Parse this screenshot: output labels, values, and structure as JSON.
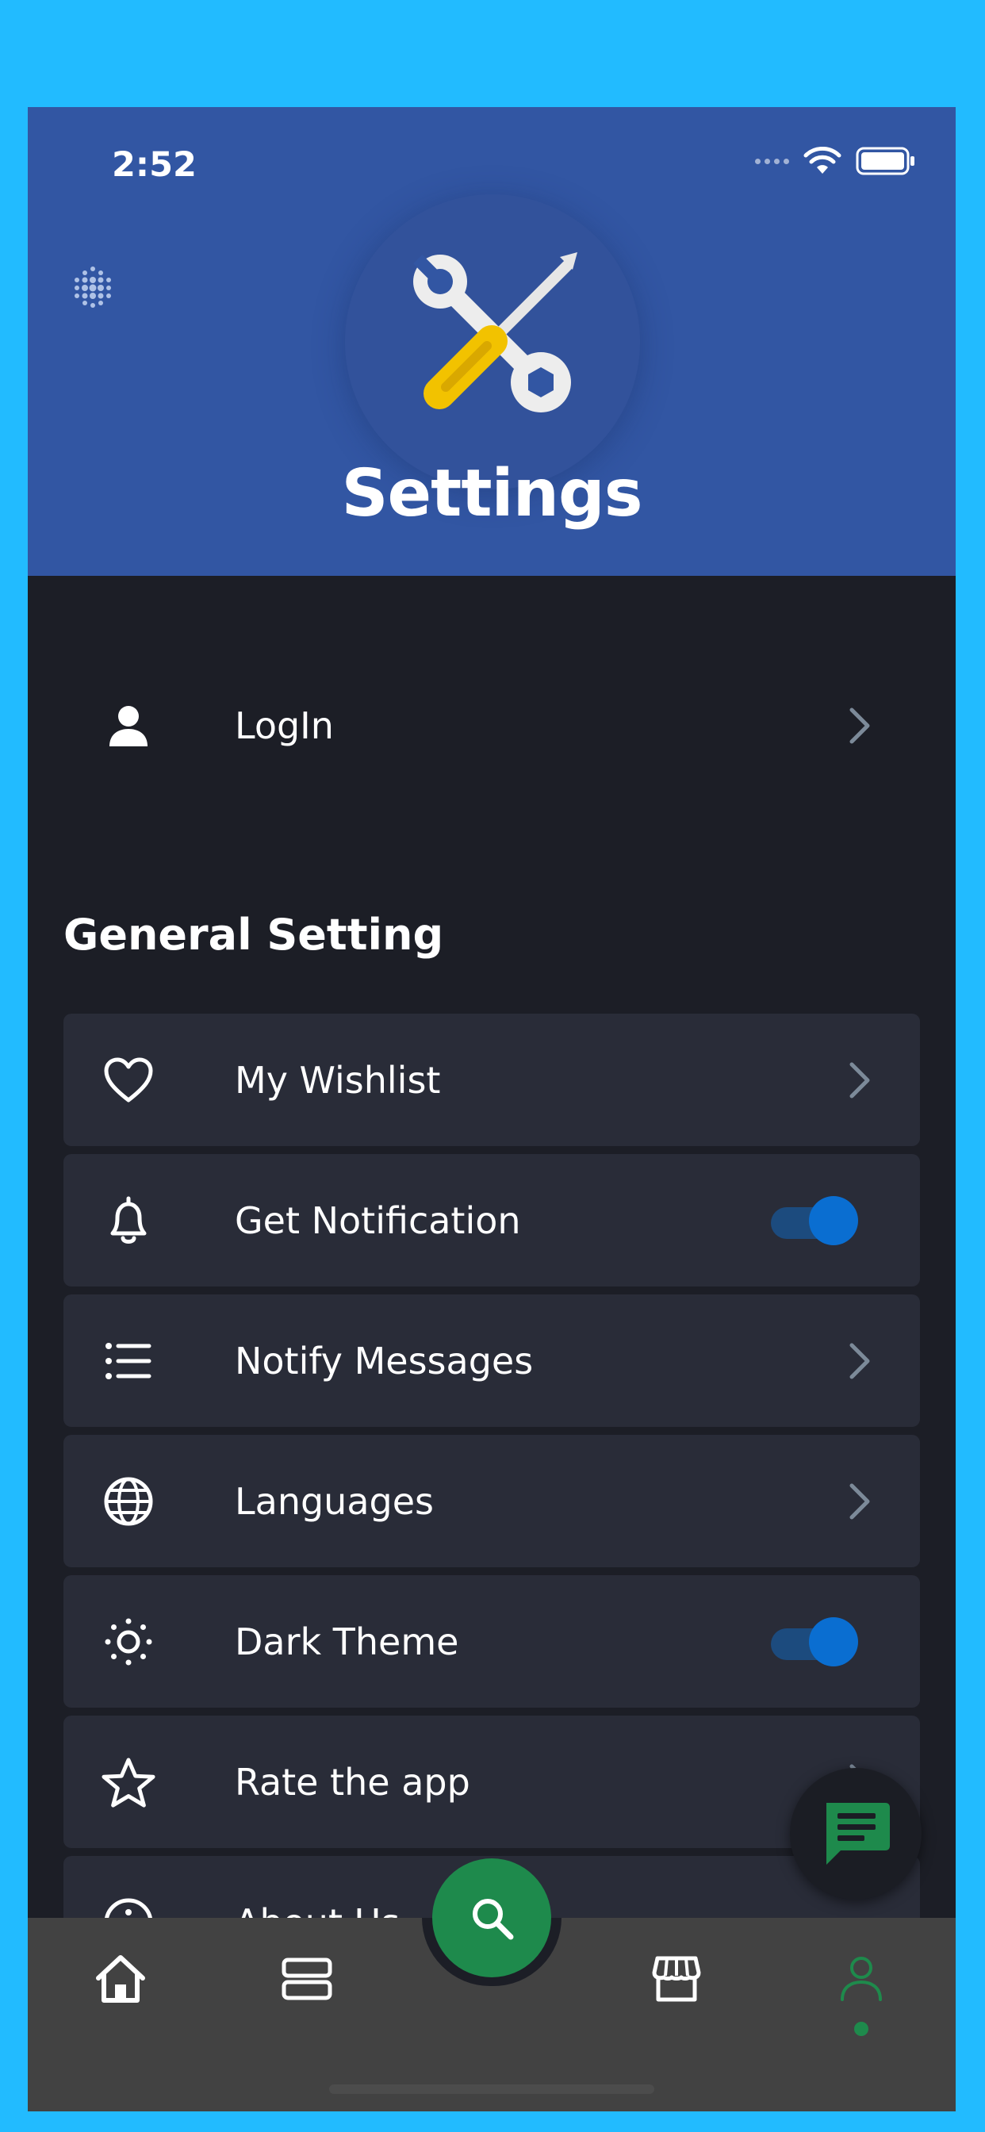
{
  "status_bar": {
    "time": "2:52"
  },
  "header": {
    "title": "Settings"
  },
  "login": {
    "label": "LogIn",
    "icon": "person-icon"
  },
  "general": {
    "section_title": "General Setting",
    "items": [
      {
        "label": "My Wishlist",
        "icon": "heart-icon",
        "control": "chevron"
      },
      {
        "label": "Get Notification",
        "icon": "bell-icon",
        "control": "toggle",
        "on": true
      },
      {
        "label": "Notify Messages",
        "icon": "list-icon",
        "control": "chevron"
      },
      {
        "label": "Languages",
        "icon": "globe-icon",
        "control": "chevron"
      },
      {
        "label": "Dark Theme",
        "icon": "sun-icon",
        "control": "toggle",
        "on": true
      },
      {
        "label": "Rate the app",
        "icon": "star-icon",
        "control": "chevron"
      },
      {
        "label": "About Us",
        "icon": "info-icon",
        "control": "none"
      }
    ]
  },
  "bottom_nav": {
    "items": [
      "home-icon",
      "list-view-icon",
      "search-icon",
      "store-icon",
      "profile-icon"
    ],
    "active": "profile-icon"
  },
  "colors": {
    "header_bg": "#3256A3",
    "page_bg": "#1C1E26",
    "card_bg": "#292C38",
    "toggle_on": "#0A6ED1",
    "accent_green": "#1E8A4C",
    "nav_bg": "#424242",
    "frame_bg": "#22BBFF"
  }
}
